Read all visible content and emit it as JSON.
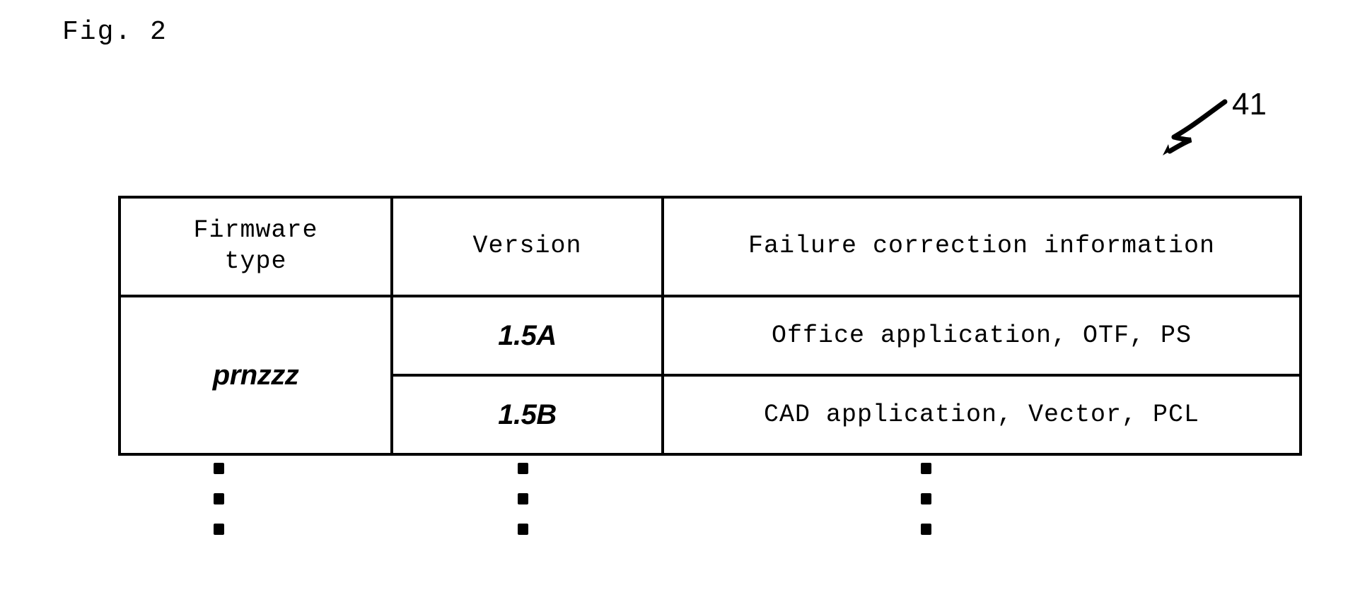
{
  "figure": {
    "title": "Fig. 2",
    "reference_numeral": "41",
    "leader_icon": "arrow-leader-icon"
  },
  "table": {
    "name": "firmware-version-table",
    "columns": [
      {
        "key": "firmware_type",
        "header": "Firmware\ntype"
      },
      {
        "key": "version",
        "header": "Version"
      },
      {
        "key": "failure_correction_information",
        "header": "Failure correction information"
      }
    ],
    "rows": [
      {
        "firmware_type": "prnzzz",
        "firmware_type_rowspan": 2,
        "version": "1.5A",
        "failure_correction_information": "Office application, OTF, PS"
      },
      {
        "version": "1.5B",
        "failure_correction_information": "CAD application, Vector, PCL"
      }
    ]
  },
  "continuation": {
    "label": "vertical-ellipsis",
    "dots_per_column": 3,
    "columns": [
      "firmware_type",
      "version",
      "failure_correction_information"
    ]
  },
  "colors": {
    "ink": "#000000",
    "paper": "#ffffff"
  }
}
